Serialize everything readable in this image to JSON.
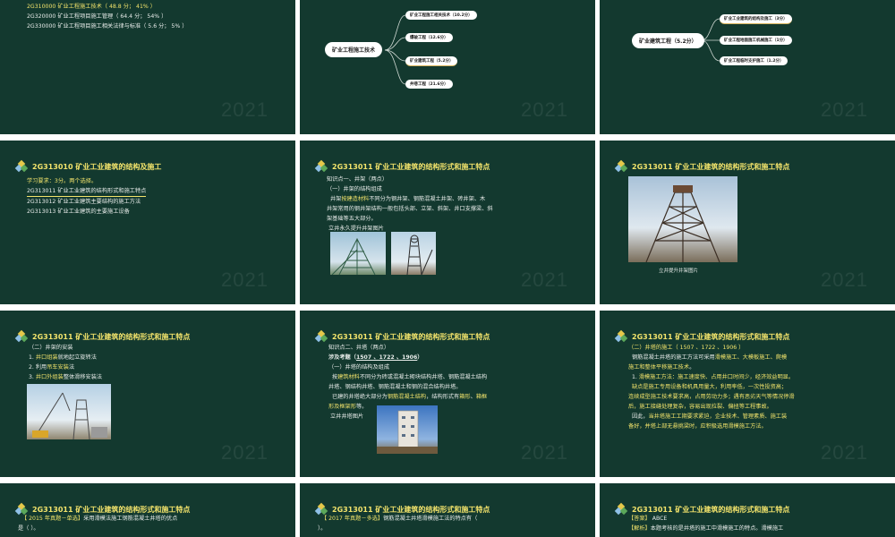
{
  "watermark": "2021",
  "slides": {
    "s1": {
      "lines": [
        "2G310000  矿业工程施工技术（ 48.8 分； 41% ）",
        "2G320000  矿业工程项目施工管理（ 64.4 分； 54% ）",
        "2G330000  矿业工程项目施工相关法律与标准（ 5.6 分； 5% ）"
      ]
    },
    "s2": {
      "center": "矿业工程施工技术",
      "nodes": [
        "矿业工程施工相关技术（10.2分）",
        "爆破工程（12.6分）",
        "矿业建筑工程（5.2分）",
        "井巷工程（21.6分）"
      ]
    },
    "s3": {
      "center": "矿业建筑工程（5.2分）",
      "nodes": [
        "矿业工业建筑的结构及施工（3分）",
        "矿业工程地面施工机械施工（1分）",
        "矿业工程临时支护施工（1.2分）"
      ]
    },
    "s4": {
      "header": "2G313010   矿业工业建筑的结构及施工",
      "req": "学习要求：3分。两个选择。",
      "items": [
        "2G313011  矿业工业建筑的结构形式和施工特点",
        "2G313012  矿业工业建筑主要结构的施工方法",
        "2G313013  矿业工业建筑的主要施工设备"
      ]
    },
    "s5": {
      "header": "2G313011   矿业工业建筑的结构形式和施工特点",
      "l1": "知识点一、井架（两点）",
      "l2": "（一）井架的结构组成",
      "l3a": "井架",
      "l3b": "按建造材料",
      "l3c": "不同分为钢井架、钢筋混凝土井架、砖井架、木",
      "l4": "井架常用的钢井架结构一般包括头部、立架、斜架、井口支撑梁、斜",
      "l5": "架基础等五大部分。",
      "l6": "立井永久提升井架图片"
    },
    "s6": {
      "header": "2G313011   矿业工业建筑的结构形式和施工特点",
      "caption": "立井提升井架图片"
    },
    "s7": {
      "header": "2G313011   矿业工业建筑的结构形式和施工特点",
      "l1": "（二）井架的安装",
      "i1a": "1. ",
      "i1b": "井口组装",
      "i1c": "就地起立旋转法",
      "i2a": "2. 利用",
      "i2b": "吊车安装",
      "i2c": "法",
      "i3a": "3. ",
      "i3b": "井口外组装",
      "i3c": "整体滑移安装法"
    },
    "s8": {
      "header": "2G313011   矿业工业建筑的结构形式和施工特点",
      "l1": "知识点二、井塔（两点）",
      "l2a": "涉及考题（",
      "years": "1507 、1722 、1906",
      "l2b": "）",
      "l3": "（一）井塔的结构及组成",
      "l4a": "按",
      "l4b": "建筑材料",
      "l4c": "不同分为砖或混凝土砌块结构井塔、钢筋混凝土结构",
      "l5": "井塔、钢结构井塔、钢筋混凝土和钢的混合结构井塔。",
      "l6a": "已建的井塔绝大部分为",
      "l6b": "钢筋混凝土结构",
      "l6c": "，结构形式有",
      "l6d": "箱形",
      "l6e": "、",
      "l6f": "箱框",
      "l7a": "形及框架形",
      "l7b": "等。",
      "l8": "立井井塔图片"
    },
    "s9": {
      "header": "2G313011   矿业工业建筑的结构形式和施工特点",
      "l1": "（二）井塔的施工（ 1507 、1722 、1906 ）",
      "l2a": "钢筋混凝土井塔的施工方法可采用",
      "l2b": "滑模施工、大模板施工、爬模",
      "l3a": "施工和整体平移施工技术",
      "l3b": "。",
      "l4a": "1. ",
      "l4b": "滑模施工方法",
      "l4c": "：施工速度快、占用井口时间少，经济效益明显。",
      "l5a": "缺点是施工",
      "l5b": "专用设备和机具用量大",
      "l5c": "，利用率低，一次性投资高；",
      "l6": "连续成型施工技术要求高，占用劳动力多；遇有恶劣天气等情况停滑",
      "l7": "后，施工接缝处理复杂，容易出现拉裂、偏扭等工程事故。",
      "l8a": "因此，",
      "l8b": "当井塔施工工期要求紧迫，企业技术、管理素质、施工装",
      "l9": "备好，并塔上部无悬挑梁时，应积极选用滑模施工方法。"
    },
    "s10": {
      "header": "2G313011   矿业工业建筑的结构形式和施工特点",
      "l1a": "【 2015 年真题－单选】",
      "l1b": "采用滑模法施工钢筋混凝土井塔的优点",
      "l2": "是（   ）。"
    },
    "s11": {
      "header": "2G313011   矿业工业建筑的结构形式和施工特点",
      "l1a": "【 2017 年真题－多选】",
      "l1b": "钢筋混凝土井塔滑模施工法的特点有（",
      "l2": "）。"
    },
    "s12": {
      "header": "2G313011   矿业工业建筑的结构形式和施工特点",
      "l1a": "【答案】",
      "l1b": "ABCE",
      "l2a": "【解析】",
      "l2b": "本题考核的是井塔的施工中滑模施工的特点。滑模施工"
    }
  }
}
